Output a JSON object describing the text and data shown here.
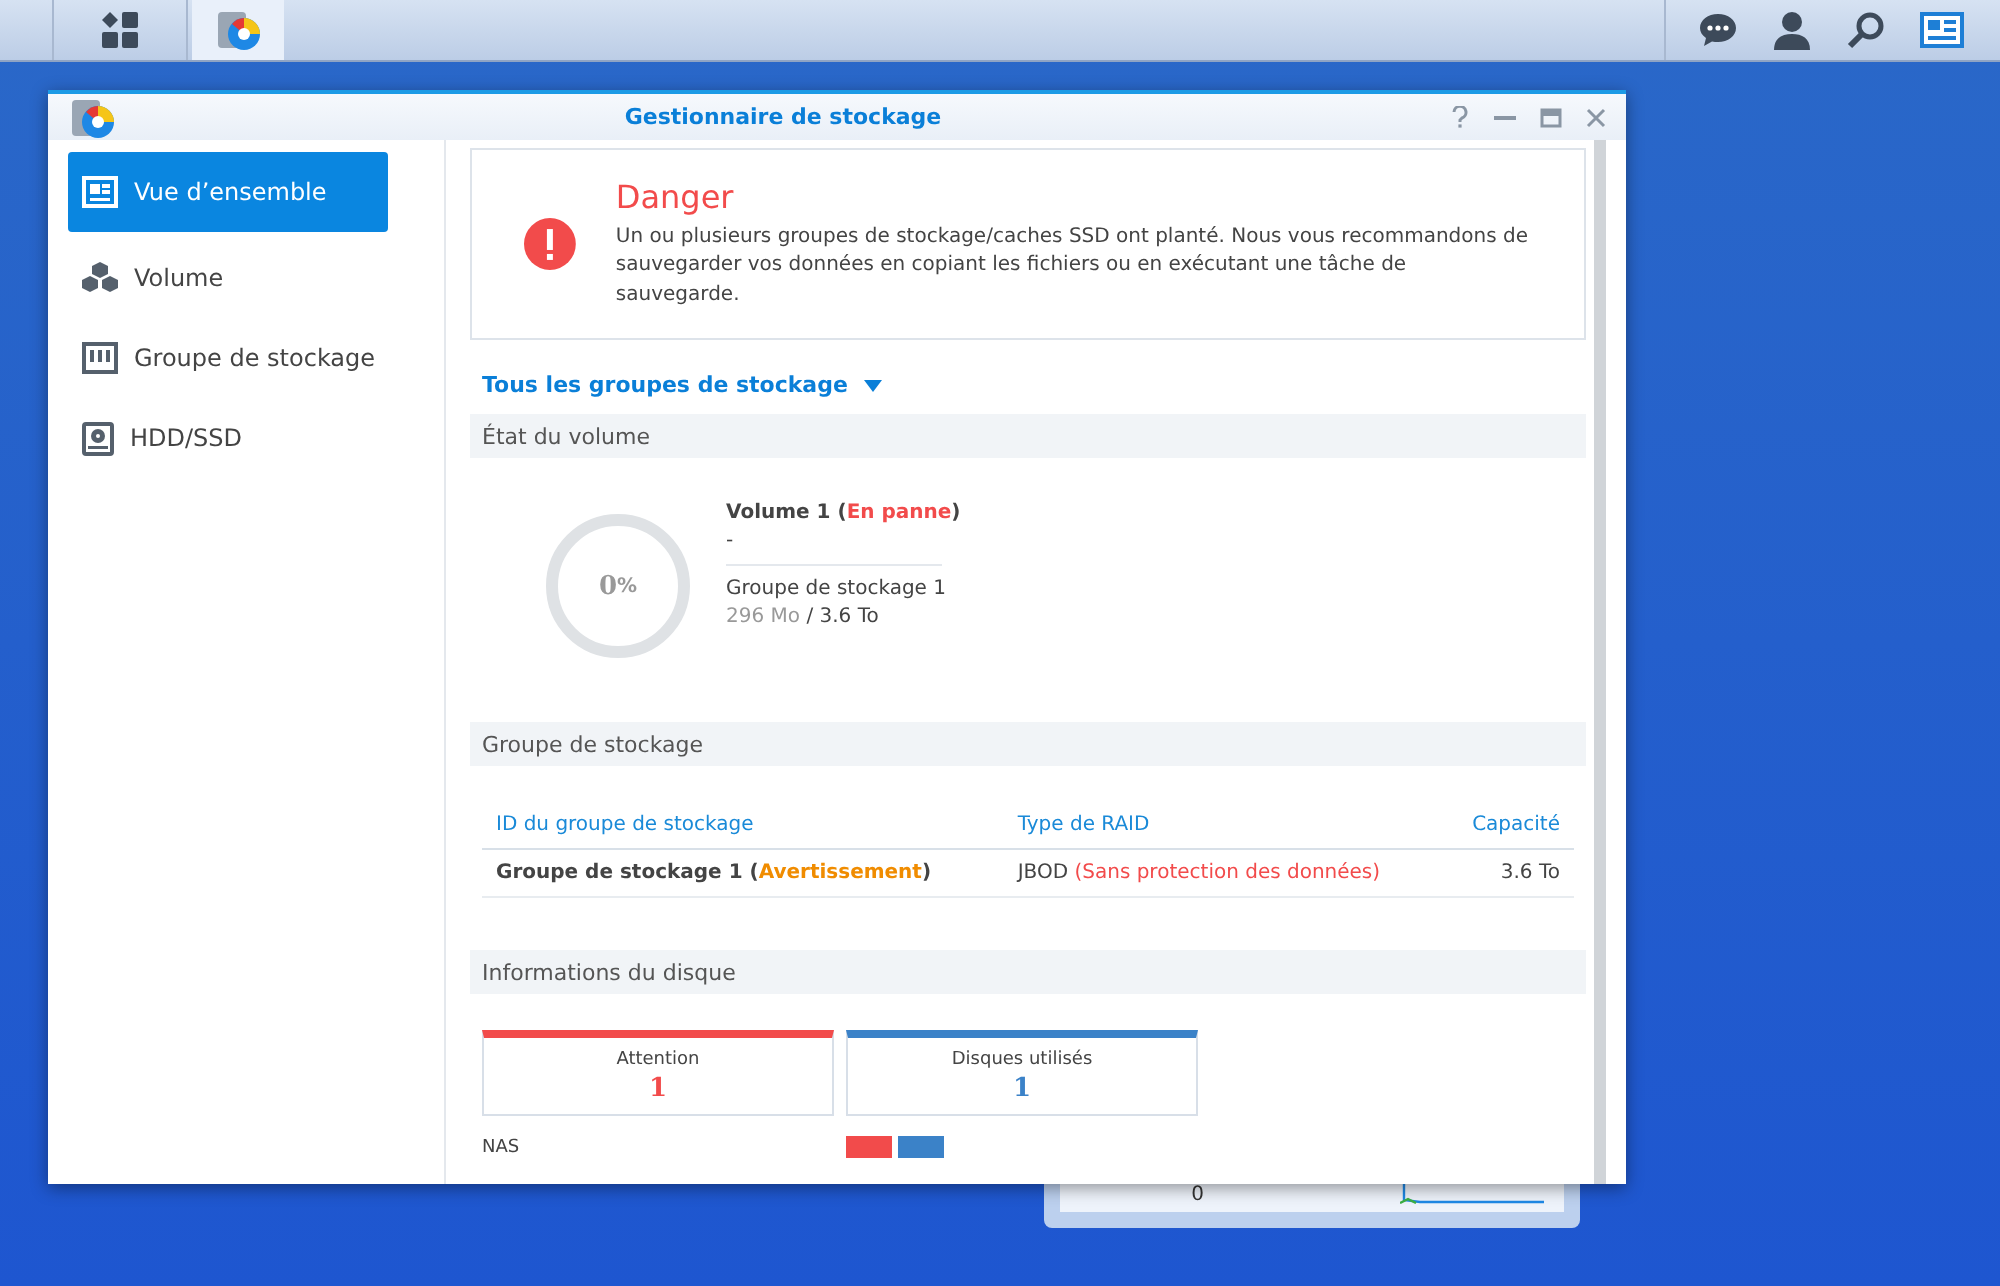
{
  "taskbar": {
    "buttons": [
      {
        "kind": "main-menu",
        "selected": false
      },
      {
        "kind": "storage-app",
        "selected": true
      }
    ]
  },
  "background_widget": {
    "axis_label": "0"
  },
  "window": {
    "title": "Gestionnaire de stockage"
  },
  "sidebar": {
    "items": [
      {
        "label": "Vue d’ensemble",
        "kind": "overview",
        "selected": true
      },
      {
        "label": "Volume",
        "kind": "volume",
        "selected": false
      },
      {
        "label": "Groupe de stockage",
        "kind": "pool",
        "selected": false
      },
      {
        "label": "HDD/SSD",
        "kind": "disk",
        "selected": false
      }
    ]
  },
  "alert": {
    "title": "Danger",
    "message": "Un ou plusieurs groupes de stockage/caches SSD ont planté. Nous vous recommandons de sauvegarder vos données en copiant les fichiers ou en exécutant une tâche de sauvegarde."
  },
  "filter": {
    "label": "Tous les groupes de stockage"
  },
  "volume_status": {
    "header": "État du volume",
    "percent": "0",
    "unit": "%",
    "level": 0,
    "name": "Volume 1 (",
    "status": "En panne",
    "status_close": ")",
    "description": "-",
    "pool": "Groupe de stockage 1",
    "used": "296 Mo",
    "total": "/ 3.6 To"
  },
  "pool_table": {
    "header": "Groupe de stockage",
    "columns": [
      "ID du groupe de stockage",
      "Type de RAID",
      "Capacité"
    ],
    "rows": [
      {
        "name": "Groupe de stockage 1 (",
        "status": "Avertissement",
        "status_close": ")",
        "raid": "JBOD",
        "raid_note": "(Sans protection des données)",
        "capacity": "3.6 To"
      }
    ]
  },
  "disk_info": {
    "header": "Informations du disque",
    "cards": [
      {
        "label": "Attention",
        "count": "1",
        "color": "#f24b4b"
      },
      {
        "label": "Disques utilisés",
        "count": "1",
        "color": "#3b82c8"
      }
    ],
    "rows": [
      {
        "label": "NAS",
        "segments": [
          {
            "color": "#f24b4b"
          },
          {
            "color": "#3b82c8"
          }
        ]
      }
    ]
  }
}
